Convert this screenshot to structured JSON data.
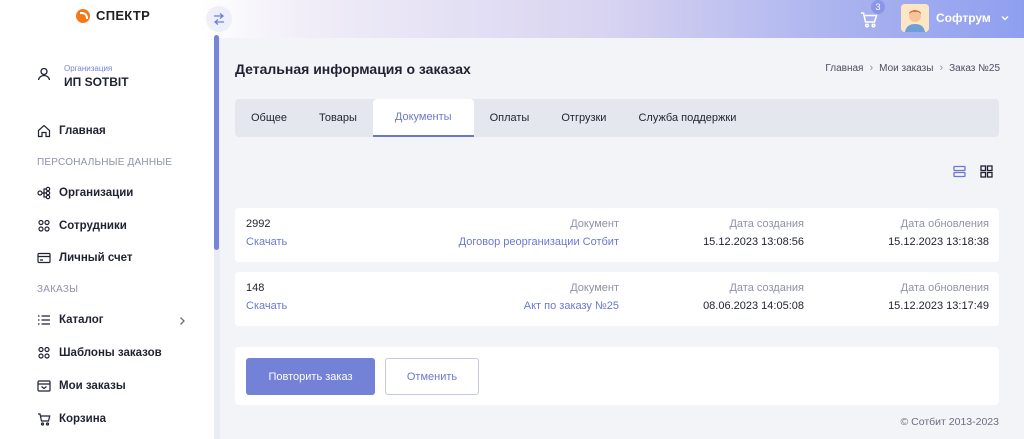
{
  "header": {
    "logo_text": "СПЕКТР",
    "cart_count": "3",
    "user_name": "Софтрум"
  },
  "sidebar": {
    "org_label": "Организация",
    "org_name": "ИП SOTBIT",
    "home": "Главная",
    "section_personal": "ПЕРСОНАЛЬНЫЕ ДАННЫЕ",
    "organizations": "Организации",
    "employees": "Сотрудники",
    "account": "Личный счет",
    "section_orders": "ЗАКАЗЫ",
    "catalog": "Каталог",
    "templates": "Шаблоны заказов",
    "my_orders": "Мои заказы",
    "cart": "Корзина"
  },
  "page": {
    "title": "Детальная информация о заказах",
    "breadcrumb": [
      "Главная",
      "Мои заказы",
      "Заказ №25"
    ]
  },
  "tabs": [
    "Общее",
    "Товары",
    "Документы",
    "Оплаты",
    "Отгрузки",
    "Служба поддержки"
  ],
  "columns": {
    "document": "Документ",
    "created": "Дата создания",
    "updated": "Дата обновления",
    "download": "Скачать"
  },
  "documents": [
    {
      "id": "2992",
      "name": "Договор реорганизации Сотбит",
      "created": "15.12.2023 13:08:56",
      "updated": "15.12.2023 13:18:38"
    },
    {
      "id": "148",
      "name": "Акт по заказу №25",
      "created": "08.06.2023 14:05:08",
      "updated": "15.12.2023 13:17:49"
    }
  ],
  "actions": {
    "repeat": "Повторить заказ",
    "cancel": "Отменить"
  },
  "footer": "© Сотбит 2013-2023",
  "colors": {
    "accent": "#7381d7",
    "link": "#6a78d2",
    "logo": "#f27a1a"
  }
}
